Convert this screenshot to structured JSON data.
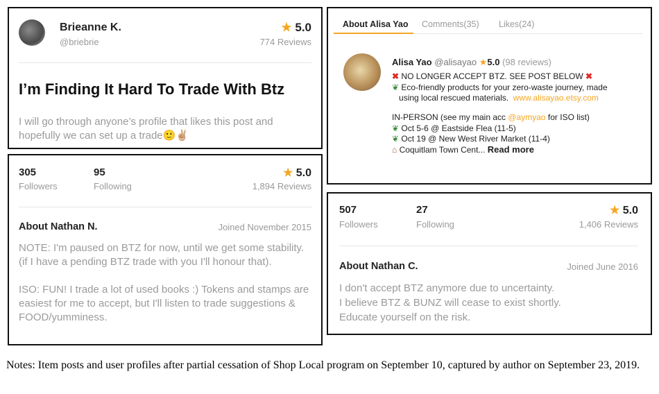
{
  "post": {
    "user_name": "Brieanne K.",
    "user_handle": "@briebrie",
    "rating": "5.0",
    "reviews": "774 Reviews",
    "title": "I’m Finding It Hard To Trade With Btz",
    "body": "I will go through anyone’s profile that likes this post and hopefully we can set up a trade",
    "body_emoji": "🙂✌🏼"
  },
  "profile_nathan_n": {
    "followers_count": "305",
    "followers_label": "Followers",
    "following_count": "95",
    "following_label": "Following",
    "rating": "5.0",
    "reviews": "1,894 Reviews",
    "about_title": "About Nathan N.",
    "joined": "Joined November 2015",
    "body_p1": "NOTE: I'm paused on BTZ for now, until we get some stability. (if I have a pending BTZ trade with you I'll honour that).",
    "body_p2": "ISO: FUN! I trade a lot of used books :) Tokens and stamps are easiest for me to accept, but I'll listen to trade suggestions & FOOD/yumminess."
  },
  "profile_alisa": {
    "tabs": [
      "About Alisa Yao",
      "Comments(35)",
      "Likes(24)"
    ],
    "name": "Alisa Yao",
    "handle": "@alisayao",
    "rating": "5.0",
    "reviews": "(98 reviews)",
    "line1": "NO LONGER ACCEPT BTZ. SEE POST BELOW",
    "line2": "Eco-friendly products for your zero-waste journey, made",
    "line3": "using local rescued materials.",
    "website": "www.alisayao.etsy.com",
    "line4a": "IN-PERSON (see my main acc ",
    "line4_handle": "@aymyao",
    "line4b": " for ISO list)",
    "event1": "Oct 5-6 @ Eastside Flea (11-5)",
    "event2": "Oct 19 @ New West River Market (11-4)",
    "event3": "Coquitlam Town Cent...",
    "read_more": "Read more"
  },
  "profile_nathan_c": {
    "followers_count": "507",
    "followers_label": "Followers",
    "following_count": "27",
    "following_label": "Following",
    "rating": "5.0",
    "reviews": "1,406 Reviews",
    "about_title": "About Nathan C.",
    "joined": "Joined June 2016",
    "body_l1": "I don't accept BTZ anymore due to uncertainty.",
    "body_l2": "I believe BTZ & BUNZ will cease to exist shortly.",
    "body_l3": "Educate yourself on the risk."
  },
  "notes": "Notes: Item posts and user profiles after partial cessation of Shop Local program on September 10, captured by author on September 23, 2019.",
  "colors": {
    "accent": "#f5a623",
    "muted": "#9a9a9a",
    "alert": "#e02b2b"
  }
}
